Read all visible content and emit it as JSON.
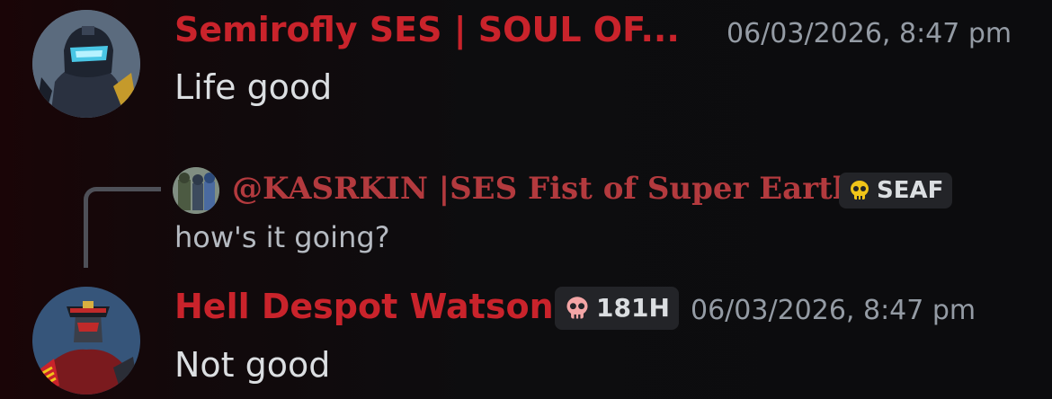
{
  "messages": [
    {
      "username": "Semirofly SES | SOUL OF...",
      "timestamp": "06/03/2026, 8:47 pm",
      "text": "Life good"
    },
    {
      "reply": {
        "username": "@KASRKIN |SES Fist of Super Earth",
        "badge": "SEAF",
        "text": "how's it going?"
      },
      "username": "Hell Despot Watson",
      "badge": "181H",
      "timestamp": "06/03/2026, 8:47 pm",
      "text": "Not good"
    }
  ],
  "colors": {
    "username": "#c9232b",
    "reply_username": "#b33a3e",
    "timestamp": "#949ba4",
    "text": "#dbdee1",
    "badge_bg": "#232428",
    "seaf_skull": "#f0c419",
    "181h_skull": "#f4a6a6"
  },
  "icons": {
    "seaf_badge_icon": "skull-icon",
    "181h_badge_icon": "skull-icon"
  }
}
